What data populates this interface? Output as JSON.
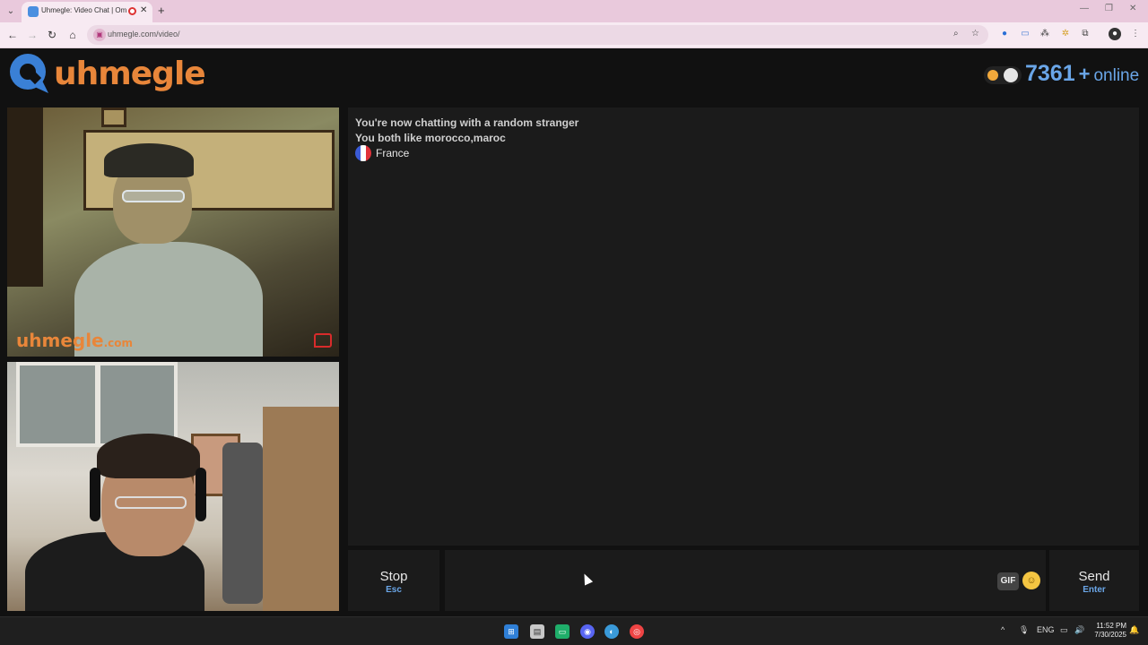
{
  "browser": {
    "tab_title": "Uhmegle: Video Chat | Omegle",
    "url": "uhmegle.com/video/",
    "new_tab": "+",
    "close": "✕",
    "window_controls": [
      "—",
      "❐",
      "✕"
    ]
  },
  "header": {
    "logo_text": "uhmegle",
    "online_count": "7361",
    "online_plus": "+",
    "online_label": "online"
  },
  "video": {
    "watermark_main": "uhmegle",
    "watermark_suffix": ".com"
  },
  "chat": {
    "messages": [
      "You're now chatting with a random stranger",
      "You both like morocco,maroc"
    ],
    "country": "France",
    "flag_colors": [
      "#3b5bd6",
      "#ffffff",
      "#e0323a"
    ]
  },
  "controls": {
    "stop_label": "Stop",
    "stop_key": "Esc",
    "send_label": "Send",
    "send_key": "Enter",
    "gif_label": "GIF",
    "emoji": "☺"
  },
  "taskbar": {
    "language": "ENG",
    "time": "11:52 PM",
    "date": "7/30/2025"
  },
  "colors": {
    "brand_orange": "#e8863a",
    "accent_blue": "#6aa6e8",
    "page_bg": "#111111",
    "panel_bg": "#1b1b1b"
  }
}
